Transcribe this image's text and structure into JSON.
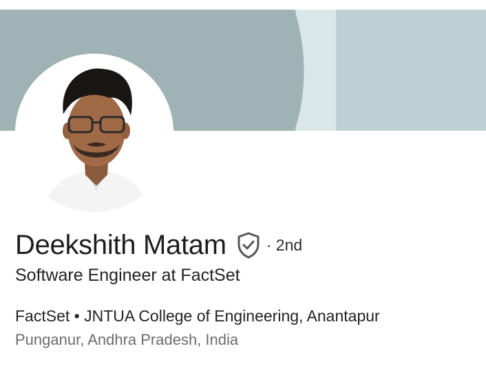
{
  "profile": {
    "name": "Deekshith Matam",
    "degree": "· 2nd",
    "headline": "Software Engineer at FactSet",
    "company_line": "FactSet • JNTUA College of Engineering, Anantapur",
    "location": "Punganur, Andhra Pradesh, India",
    "verified_icon": "shield-check-icon",
    "avatar_icon": "profile-photo"
  },
  "colors": {
    "banner_dark": "#9fb3b5",
    "banner_light": "#bdd1d3",
    "banner_pale": "#dae7e8",
    "name_text": "#1d1d1d",
    "location_text": "#6b6b6b"
  }
}
